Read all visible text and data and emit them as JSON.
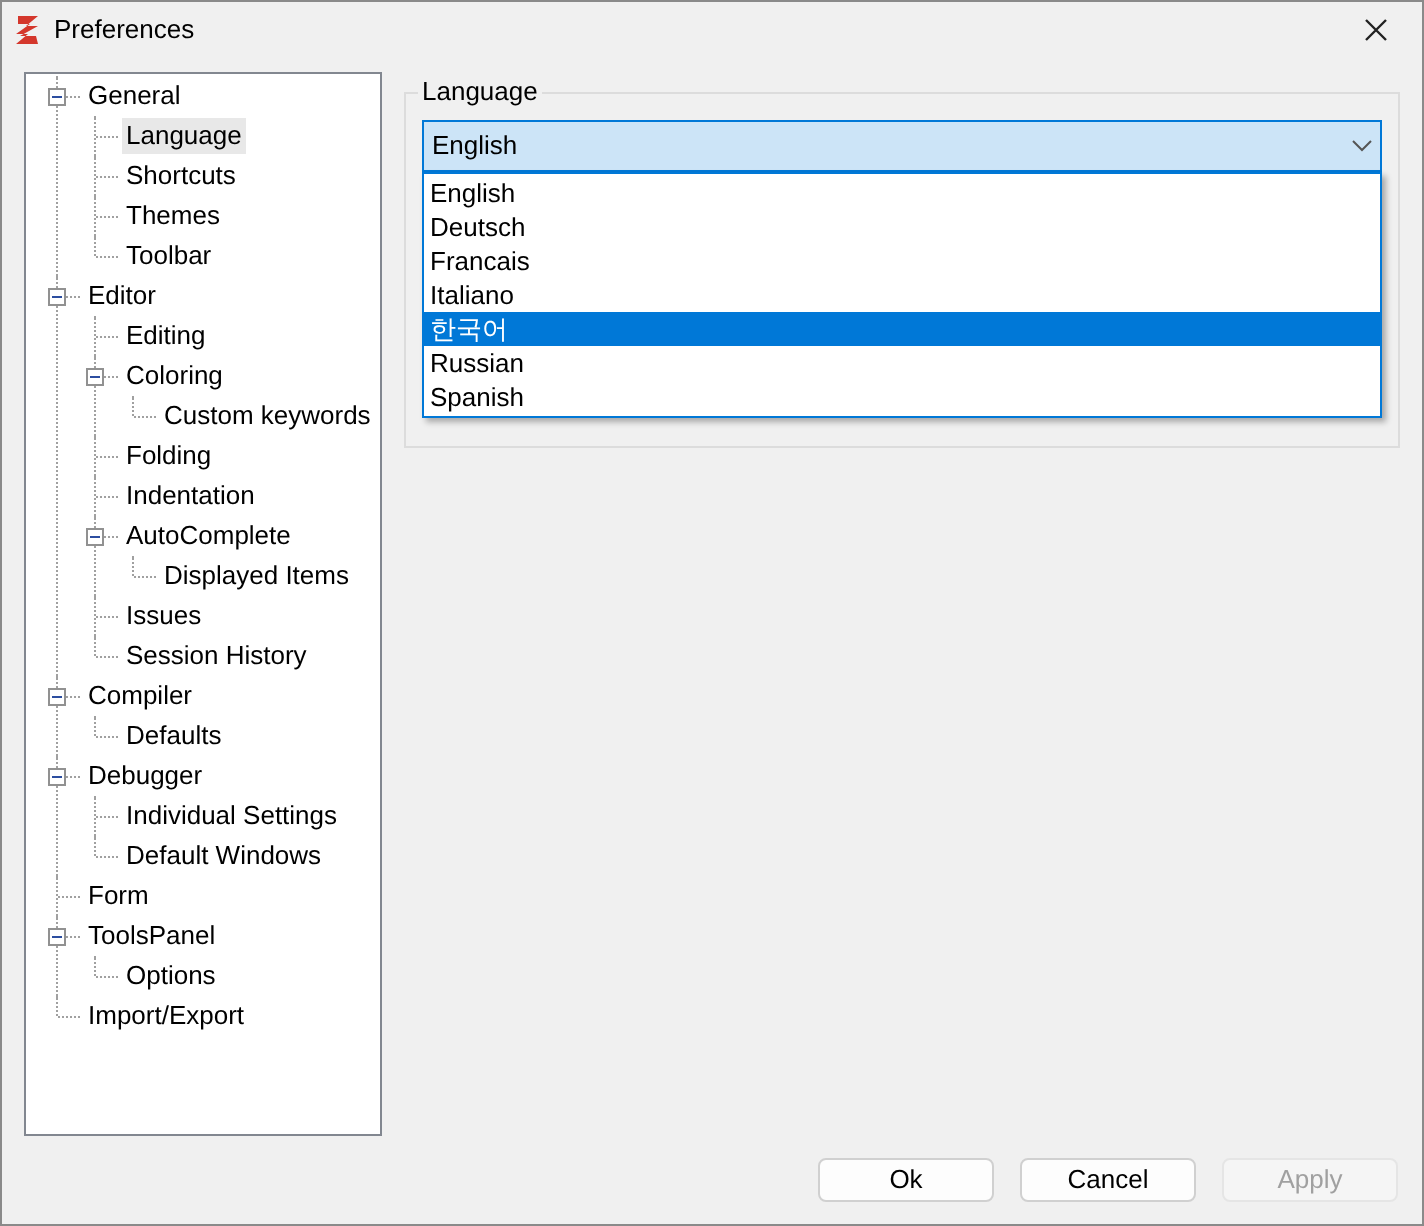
{
  "window": {
    "title": "Preferences"
  },
  "tree": [
    {
      "label": "General",
      "selected": false,
      "expanded": true,
      "children": [
        {
          "label": "Language",
          "selected": true
        },
        {
          "label": "Shortcuts",
          "selected": false
        },
        {
          "label": "Themes",
          "selected": false
        },
        {
          "label": "Toolbar",
          "selected": false
        }
      ]
    },
    {
      "label": "Editor",
      "selected": false,
      "expanded": true,
      "children": [
        {
          "label": "Editing",
          "selected": false
        },
        {
          "label": "Coloring",
          "selected": false,
          "expanded": true,
          "children": [
            {
              "label": "Custom keywords",
              "selected": false
            }
          ]
        },
        {
          "label": "Folding",
          "selected": false
        },
        {
          "label": "Indentation",
          "selected": false
        },
        {
          "label": "AutoComplete",
          "selected": false,
          "expanded": true,
          "children": [
            {
              "label": "Displayed Items",
              "selected": false
            }
          ]
        },
        {
          "label": "Issues",
          "selected": false
        },
        {
          "label": "Session History",
          "selected": false
        }
      ]
    },
    {
      "label": "Compiler",
      "selected": false,
      "expanded": true,
      "children": [
        {
          "label": "Defaults",
          "selected": false
        }
      ]
    },
    {
      "label": "Debugger",
      "selected": false,
      "expanded": true,
      "children": [
        {
          "label": "Individual Settings",
          "selected": false
        },
        {
          "label": "Default Windows",
          "selected": false
        }
      ]
    },
    {
      "label": "Form",
      "selected": false
    },
    {
      "label": "ToolsPanel",
      "selected": false,
      "expanded": true,
      "children": [
        {
          "label": "Options",
          "selected": false
        }
      ]
    },
    {
      "label": "Import/Export",
      "selected": false
    }
  ],
  "language_group": {
    "title": "Language",
    "combo": {
      "value": "English",
      "open": true
    },
    "options": [
      {
        "label": "English",
        "selected": false
      },
      {
        "label": "Deutsch",
        "selected": false
      },
      {
        "label": "Francais",
        "selected": false
      },
      {
        "label": "Italiano",
        "selected": false
      },
      {
        "label": "한국어",
        "selected": true
      },
      {
        "label": "Russian",
        "selected": false
      },
      {
        "label": "Spanish",
        "selected": false
      }
    ]
  },
  "buttons": [
    {
      "label": "Ok",
      "disabled": false
    },
    {
      "label": "Cancel",
      "disabled": false
    },
    {
      "label": "Apply",
      "disabled": true
    }
  ]
}
